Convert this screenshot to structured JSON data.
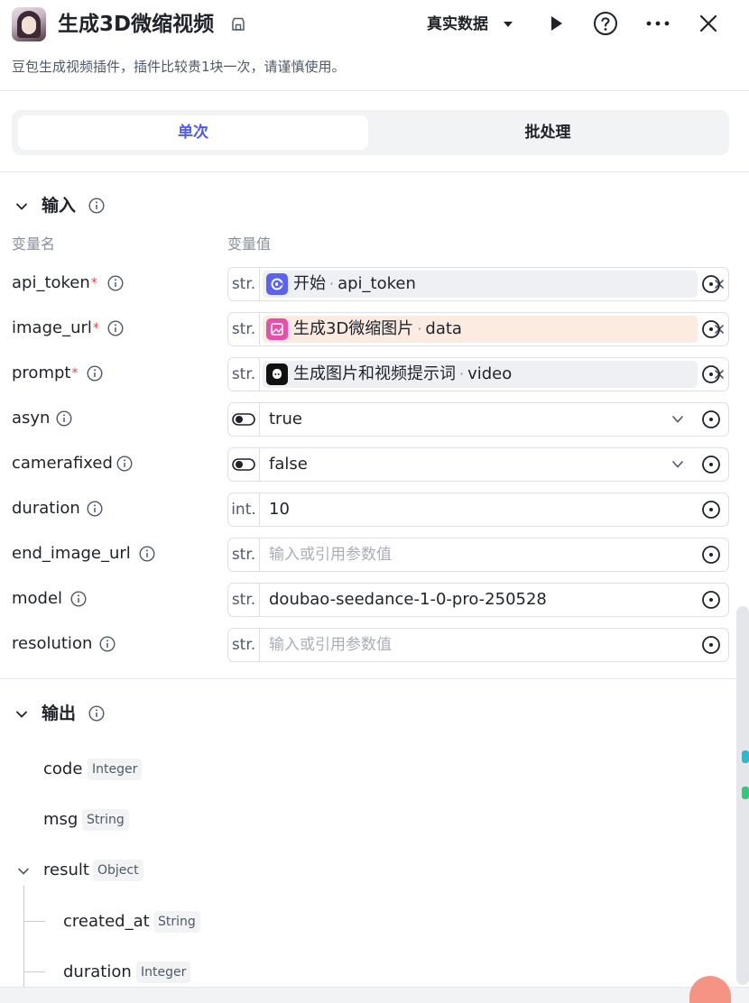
{
  "header": {
    "title": "生成3D微缩视频",
    "realdata_label": "真实数据",
    "subtitle": "豆包生成视频插件，插件比较贵1块一次，请谨慎使用。"
  },
  "tabs": [
    {
      "label": "单次",
      "active": true
    },
    {
      "label": "批处理",
      "active": false
    }
  ],
  "input": {
    "section_title": "输入",
    "col_name": "变量名",
    "col_value": "变量值",
    "params": [
      {
        "name": "api_token",
        "required": true,
        "type": "str.",
        "kind": "ref",
        "ref_source": "开始",
        "ref_field": "api_token",
        "ref_icon": "start-node-icon"
      },
      {
        "name": "image_url",
        "required": true,
        "type": "str.",
        "kind": "ref",
        "ref_source": "生成3D微缩图片",
        "ref_field": "data",
        "ref_icon": "image-node-icon"
      },
      {
        "name": "prompt",
        "required": true,
        "type": "str.",
        "kind": "ref",
        "ref_source": "生成图片和视频提示词",
        "ref_field": "video",
        "ref_icon": "llm-node-icon"
      },
      {
        "name": "asyn",
        "required": false,
        "type": "toggle",
        "kind": "select",
        "value": "true"
      },
      {
        "name": "camerafixed",
        "required": false,
        "type": "toggle",
        "kind": "select",
        "value": "false"
      },
      {
        "name": "duration",
        "required": false,
        "type": "int.",
        "kind": "text",
        "value": "10"
      },
      {
        "name": "end_image_url",
        "required": false,
        "type": "str.",
        "kind": "text",
        "value": "",
        "placeholder": "输入或引用参数值"
      },
      {
        "name": "model",
        "required": false,
        "type": "str.",
        "kind": "text",
        "value": "doubao-seedance-1-0-pro-250528"
      },
      {
        "name": "resolution",
        "required": false,
        "type": "str.",
        "kind": "text",
        "value": "",
        "placeholder": "输入或引用参数值"
      }
    ]
  },
  "output": {
    "section_title": "输出",
    "fields": [
      {
        "name": "code",
        "type": "Integer",
        "level": 0
      },
      {
        "name": "msg",
        "type": "String",
        "level": 0
      },
      {
        "name": "result",
        "type": "Object",
        "level": 0,
        "expanded": true
      },
      {
        "name": "created_at",
        "type": "String",
        "level": 1
      },
      {
        "name": "duration",
        "type": "Integer",
        "level": 1
      }
    ]
  },
  "colors": {
    "accent": "#4e5bf2",
    "required": "#f53f3f",
    "ref_warn_bg": "#fbebe1",
    "start_icon": "#5a63f0",
    "image_icon": "#e84fa8"
  }
}
